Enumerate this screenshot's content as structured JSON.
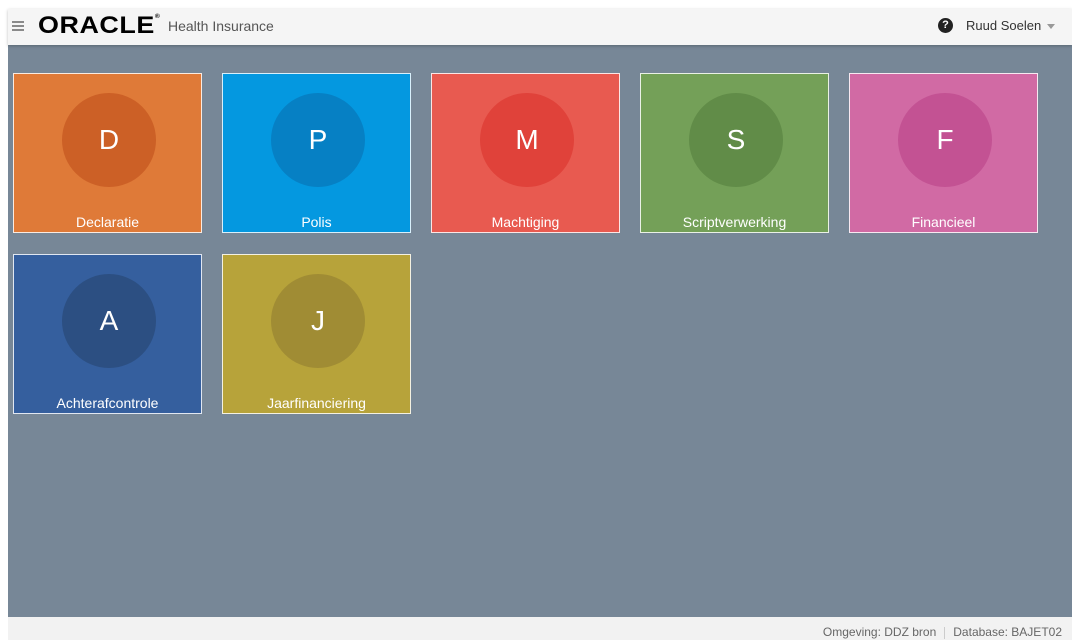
{
  "header": {
    "logo_text": "ORACLE",
    "logo_mark": "®",
    "app_name": "Health Insurance",
    "help_icon_glyph": "?",
    "user_name": "Ruud Soelen"
  },
  "tiles": [
    {
      "letter": "D",
      "label": "Declaratie",
      "color": "#df7a38",
      "circle_color": "#cc6026"
    },
    {
      "letter": "P",
      "label": "Polis",
      "color": "#0498e0",
      "circle_color": "#0680c4"
    },
    {
      "letter": "M",
      "label": "Machtiging",
      "color": "#e85a50",
      "circle_color": "#e0423a"
    },
    {
      "letter": "S",
      "label": "Scriptverwerking",
      "color": "#74a058",
      "circle_color": "#618c48"
    },
    {
      "letter": "F",
      "label": "Financieel",
      "color": "#d16aa4",
      "circle_color": "#c35293"
    },
    {
      "letter": "A",
      "label": "Achterafcontrole",
      "color": "#355f9e",
      "circle_color": "#2c4f82"
    },
    {
      "letter": "J",
      "label": "Jaarfinanciering",
      "color": "#b7a33a",
      "circle_color": "#a08c34"
    }
  ],
  "footer": {
    "environment": "Omgeving: DDZ bron",
    "database": "Database: BAJET02"
  },
  "colors": {
    "background": "#778797",
    "header_bg": "#f5f5f5",
    "footer_bg": "#f2f2f2"
  }
}
